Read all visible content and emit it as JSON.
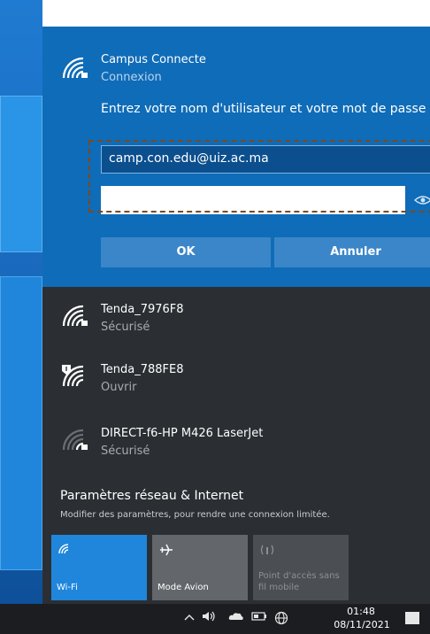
{
  "connect": {
    "network_name": "Campus Connecte",
    "status": "Connexion",
    "prompt": "Entrez votre nom d'utilisateur et votre mot de passe",
    "username_value": "camp.con.edu@uiz.ac.ma",
    "password_value": "",
    "ok_label": "OK",
    "cancel_label": "Annuler"
  },
  "networks": [
    {
      "name": "Tenda_7976F8",
      "status": "Sécurisé",
      "icon": "wifi-secured-icon"
    },
    {
      "name": "Tenda_788FE8",
      "status": "Ouvrir",
      "icon": "wifi-open-warning-icon"
    },
    {
      "name": "DIRECT-f6-HP M426 LaserJet",
      "status": "Sécurisé",
      "icon": "wifi-weak-icon"
    }
  ],
  "settings": {
    "title": "Paramètres réseau & Internet",
    "description": "Modifier des paramètres, pour rendre une connexion limitée."
  },
  "tiles": [
    {
      "label": "Wi-Fi",
      "icon": "wifi-icon",
      "active": true
    },
    {
      "label": "Mode Avion",
      "icon": "airplane-icon",
      "active": false
    },
    {
      "label": "Point d'accès sans fil mobile",
      "icon": "hotspot-icon",
      "active": false
    }
  ],
  "taskbar": {
    "time": "01:48",
    "date": "08/11/2021"
  },
  "colors": {
    "accent": "#0f6cb8",
    "flyout_bg": "#2b2f33",
    "tile_active": "#1f86dc"
  }
}
